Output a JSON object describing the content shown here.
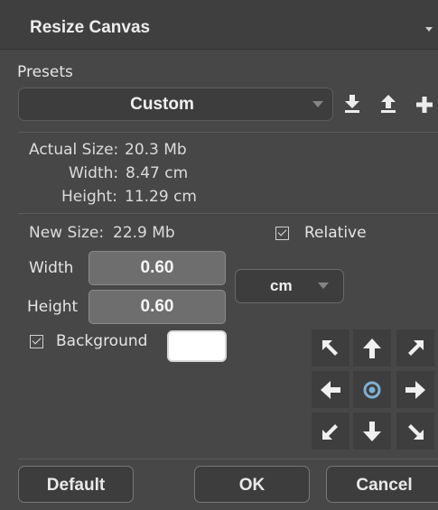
{
  "panel": {
    "title": "Resize Canvas"
  },
  "presets": {
    "label": "Presets",
    "selected": "Custom",
    "icons": [
      "download-icon",
      "upload-icon",
      "plus-icon"
    ]
  },
  "actual_size": {
    "label": "Actual Size:",
    "value": "20.3 Mb",
    "width_label": "Width:",
    "width_value": "8.47 cm",
    "height_label": "Height:",
    "height_value": "11.29 cm"
  },
  "new_size": {
    "label": "New Size:",
    "value": "22.9 Mb",
    "relative_label": "Relative",
    "relative_checked": true,
    "width_label": "Width",
    "width_value": "0.60",
    "height_label": "Height",
    "height_value": "0.60",
    "unit": "cm",
    "background_label": "Background",
    "background_checked": true,
    "background_color": "#ffffff"
  },
  "anchor": {
    "cells": [
      "arrow-up-left-icon",
      "arrow-up-icon",
      "arrow-up-right-icon",
      "arrow-left-icon",
      "anchor-center-icon",
      "arrow-right-icon",
      "arrow-down-left-icon",
      "arrow-down-icon",
      "arrow-down-right-icon"
    ],
    "selected": "center"
  },
  "buttons": {
    "default": "Default",
    "ok": "OK",
    "cancel": "Cancel"
  }
}
